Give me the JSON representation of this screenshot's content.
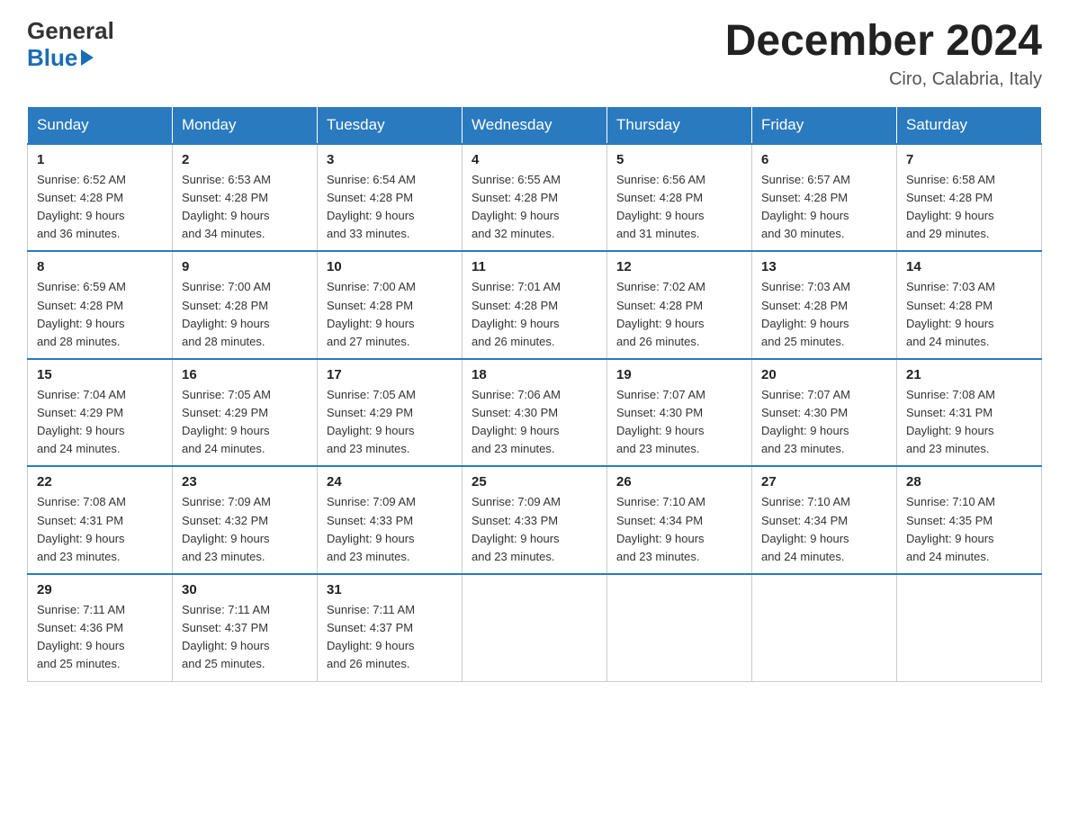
{
  "header": {
    "logo_general": "General",
    "logo_blue": "Blue",
    "month_title": "December 2024",
    "location": "Ciro, Calabria, Italy"
  },
  "weekdays": [
    "Sunday",
    "Monday",
    "Tuesday",
    "Wednesday",
    "Thursday",
    "Friday",
    "Saturday"
  ],
  "weeks": [
    [
      {
        "day": "1",
        "sunrise": "6:52 AM",
        "sunset": "4:28 PM",
        "daylight": "9 hours and 36 minutes."
      },
      {
        "day": "2",
        "sunrise": "6:53 AM",
        "sunset": "4:28 PM",
        "daylight": "9 hours and 34 minutes."
      },
      {
        "day": "3",
        "sunrise": "6:54 AM",
        "sunset": "4:28 PM",
        "daylight": "9 hours and 33 minutes."
      },
      {
        "day": "4",
        "sunrise": "6:55 AM",
        "sunset": "4:28 PM",
        "daylight": "9 hours and 32 minutes."
      },
      {
        "day": "5",
        "sunrise": "6:56 AM",
        "sunset": "4:28 PM",
        "daylight": "9 hours and 31 minutes."
      },
      {
        "day": "6",
        "sunrise": "6:57 AM",
        "sunset": "4:28 PM",
        "daylight": "9 hours and 30 minutes."
      },
      {
        "day": "7",
        "sunrise": "6:58 AM",
        "sunset": "4:28 PM",
        "daylight": "9 hours and 29 minutes."
      }
    ],
    [
      {
        "day": "8",
        "sunrise": "6:59 AM",
        "sunset": "4:28 PM",
        "daylight": "9 hours and 28 minutes."
      },
      {
        "day": "9",
        "sunrise": "7:00 AM",
        "sunset": "4:28 PM",
        "daylight": "9 hours and 28 minutes."
      },
      {
        "day": "10",
        "sunrise": "7:00 AM",
        "sunset": "4:28 PM",
        "daylight": "9 hours and 27 minutes."
      },
      {
        "day": "11",
        "sunrise": "7:01 AM",
        "sunset": "4:28 PM",
        "daylight": "9 hours and 26 minutes."
      },
      {
        "day": "12",
        "sunrise": "7:02 AM",
        "sunset": "4:28 PM",
        "daylight": "9 hours and 26 minutes."
      },
      {
        "day": "13",
        "sunrise": "7:03 AM",
        "sunset": "4:28 PM",
        "daylight": "9 hours and 25 minutes."
      },
      {
        "day": "14",
        "sunrise": "7:03 AM",
        "sunset": "4:28 PM",
        "daylight": "9 hours and 24 minutes."
      }
    ],
    [
      {
        "day": "15",
        "sunrise": "7:04 AM",
        "sunset": "4:29 PM",
        "daylight": "9 hours and 24 minutes."
      },
      {
        "day": "16",
        "sunrise": "7:05 AM",
        "sunset": "4:29 PM",
        "daylight": "9 hours and 24 minutes."
      },
      {
        "day": "17",
        "sunrise": "7:05 AM",
        "sunset": "4:29 PM",
        "daylight": "9 hours and 23 minutes."
      },
      {
        "day": "18",
        "sunrise": "7:06 AM",
        "sunset": "4:30 PM",
        "daylight": "9 hours and 23 minutes."
      },
      {
        "day": "19",
        "sunrise": "7:07 AM",
        "sunset": "4:30 PM",
        "daylight": "9 hours and 23 minutes."
      },
      {
        "day": "20",
        "sunrise": "7:07 AM",
        "sunset": "4:30 PM",
        "daylight": "9 hours and 23 minutes."
      },
      {
        "day": "21",
        "sunrise": "7:08 AM",
        "sunset": "4:31 PM",
        "daylight": "9 hours and 23 minutes."
      }
    ],
    [
      {
        "day": "22",
        "sunrise": "7:08 AM",
        "sunset": "4:31 PM",
        "daylight": "9 hours and 23 minutes."
      },
      {
        "day": "23",
        "sunrise": "7:09 AM",
        "sunset": "4:32 PM",
        "daylight": "9 hours and 23 minutes."
      },
      {
        "day": "24",
        "sunrise": "7:09 AM",
        "sunset": "4:33 PM",
        "daylight": "9 hours and 23 minutes."
      },
      {
        "day": "25",
        "sunrise": "7:09 AM",
        "sunset": "4:33 PM",
        "daylight": "9 hours and 23 minutes."
      },
      {
        "day": "26",
        "sunrise": "7:10 AM",
        "sunset": "4:34 PM",
        "daylight": "9 hours and 23 minutes."
      },
      {
        "day": "27",
        "sunrise": "7:10 AM",
        "sunset": "4:34 PM",
        "daylight": "9 hours and 24 minutes."
      },
      {
        "day": "28",
        "sunrise": "7:10 AM",
        "sunset": "4:35 PM",
        "daylight": "9 hours and 24 minutes."
      }
    ],
    [
      {
        "day": "29",
        "sunrise": "7:11 AM",
        "sunset": "4:36 PM",
        "daylight": "9 hours and 25 minutes."
      },
      {
        "day": "30",
        "sunrise": "7:11 AM",
        "sunset": "4:37 PM",
        "daylight": "9 hours and 25 minutes."
      },
      {
        "day": "31",
        "sunrise": "7:11 AM",
        "sunset": "4:37 PM",
        "daylight": "9 hours and 26 minutes."
      },
      null,
      null,
      null,
      null
    ]
  ],
  "labels": {
    "sunrise": "Sunrise:",
    "sunset": "Sunset:",
    "daylight": "Daylight:"
  }
}
